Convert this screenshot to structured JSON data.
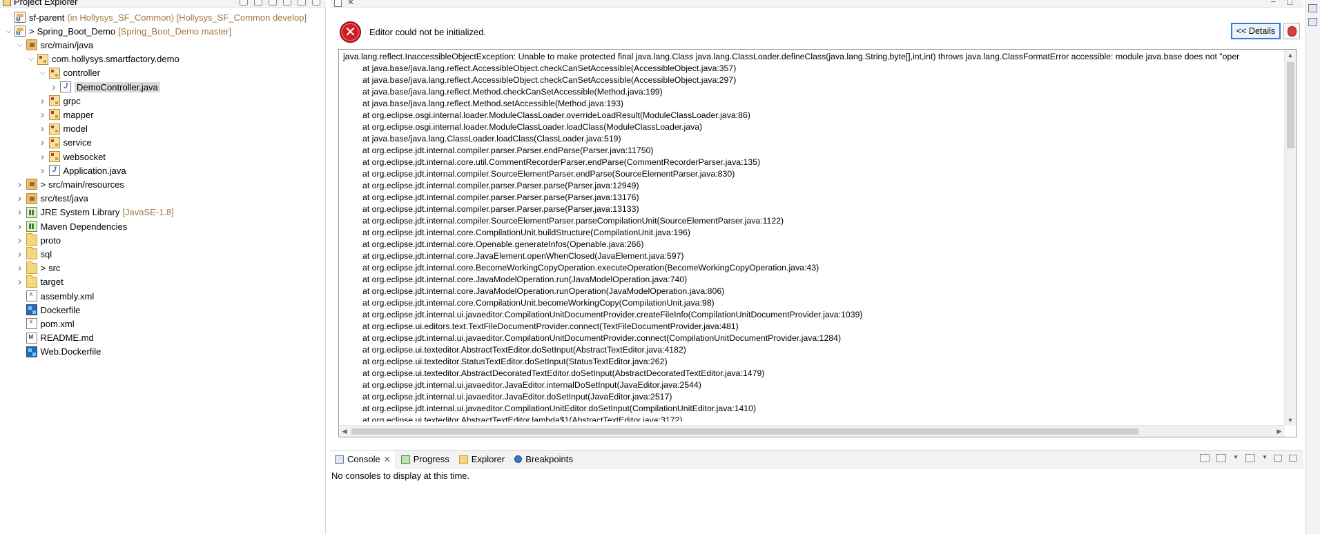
{
  "explorer": {
    "title": "Project Explorer",
    "tree": [
      {
        "id": "sf-parent",
        "depth": 0,
        "expanded": false,
        "twisty": false,
        "icon": "project-icon",
        "prefix": "",
        "label": "sf-parent",
        "decoration": "(in Hollysys_SF_Common) [Hollysys_SF_Common develop]"
      },
      {
        "id": "spring-boot-demo",
        "depth": 0,
        "expanded": true,
        "twisty": true,
        "icon": "project-icon",
        "prefix": ">",
        "label": "Spring_Boot_Demo",
        "decoration": "[Spring_Boot_Demo master]"
      },
      {
        "id": "src-main-java",
        "depth": 1,
        "expanded": true,
        "twisty": true,
        "icon": "source-folder-icon",
        "prefix": "",
        "label": "src/main/java",
        "decoration": ""
      },
      {
        "id": "pkg-demo",
        "depth": 2,
        "expanded": true,
        "twisty": true,
        "icon": "package-icon",
        "prefix": "",
        "label": "com.hollysys.smartfactory.demo",
        "decoration": ""
      },
      {
        "id": "pkg-controller",
        "depth": 3,
        "expanded": true,
        "twisty": true,
        "icon": "package-icon",
        "prefix": "",
        "label": "controller",
        "decoration": ""
      },
      {
        "id": "demo-controller",
        "depth": 4,
        "expanded": false,
        "twisty": true,
        "icon": "java-file-icon",
        "prefix": "",
        "label": "DemoController.java",
        "decoration": "",
        "selected": true
      },
      {
        "id": "pkg-grpc",
        "depth": 3,
        "expanded": false,
        "twisty": true,
        "icon": "package-icon",
        "prefix": "",
        "label": "grpc",
        "decoration": ""
      },
      {
        "id": "pkg-mapper",
        "depth": 3,
        "expanded": false,
        "twisty": true,
        "icon": "package-icon",
        "prefix": "",
        "label": "mapper",
        "decoration": ""
      },
      {
        "id": "pkg-model",
        "depth": 3,
        "expanded": false,
        "twisty": true,
        "icon": "package-icon",
        "prefix": "",
        "label": "model",
        "decoration": ""
      },
      {
        "id": "pkg-service",
        "depth": 3,
        "expanded": false,
        "twisty": true,
        "icon": "package-icon",
        "prefix": "",
        "label": "service",
        "decoration": ""
      },
      {
        "id": "pkg-websocket",
        "depth": 3,
        "expanded": false,
        "twisty": true,
        "icon": "package-icon",
        "prefix": "",
        "label": "websocket",
        "decoration": ""
      },
      {
        "id": "application",
        "depth": 3,
        "expanded": false,
        "twisty": true,
        "icon": "java-file-icon",
        "prefix": "",
        "label": "Application.java",
        "decoration": ""
      },
      {
        "id": "src-main-resources",
        "depth": 1,
        "expanded": false,
        "twisty": true,
        "icon": "source-folder-icon",
        "prefix": ">",
        "label": "src/main/resources",
        "decoration": ""
      },
      {
        "id": "src-test-java",
        "depth": 1,
        "expanded": false,
        "twisty": true,
        "icon": "source-folder-icon",
        "prefix": "",
        "label": "src/test/java",
        "decoration": ""
      },
      {
        "id": "jre",
        "depth": 1,
        "expanded": false,
        "twisty": true,
        "icon": "library-icon",
        "prefix": "",
        "label": "JRE System Library",
        "decoration": "[JavaSE-1.8]"
      },
      {
        "id": "maven-deps",
        "depth": 1,
        "expanded": false,
        "twisty": true,
        "icon": "library-icon",
        "prefix": "",
        "label": "Maven Dependencies",
        "decoration": ""
      },
      {
        "id": "proto",
        "depth": 1,
        "expanded": false,
        "twisty": true,
        "icon": "folder-icon",
        "prefix": "",
        "label": "proto",
        "decoration": ""
      },
      {
        "id": "sql",
        "depth": 1,
        "expanded": false,
        "twisty": true,
        "icon": "folder-icon",
        "prefix": "",
        "label": "sql",
        "decoration": ""
      },
      {
        "id": "src",
        "depth": 1,
        "expanded": false,
        "twisty": true,
        "icon": "folder-icon",
        "prefix": ">",
        "label": "src",
        "decoration": ""
      },
      {
        "id": "target",
        "depth": 1,
        "expanded": false,
        "twisty": true,
        "icon": "folder-icon",
        "prefix": "",
        "label": "target",
        "decoration": ""
      },
      {
        "id": "assembly",
        "depth": 1,
        "expanded": false,
        "twisty": false,
        "icon": "xml-file-icon",
        "prefix": "",
        "label": "assembly.xml",
        "decoration": ""
      },
      {
        "id": "dockerfile",
        "depth": 1,
        "expanded": false,
        "twisty": false,
        "icon": "docker-file-icon",
        "prefix": "",
        "label": "Dockerfile",
        "decoration": ""
      },
      {
        "id": "pom",
        "depth": 1,
        "expanded": false,
        "twisty": false,
        "icon": "xml-file-icon",
        "prefix": "",
        "label": "pom.xml",
        "decoration": ""
      },
      {
        "id": "readme",
        "depth": 1,
        "expanded": false,
        "twisty": false,
        "icon": "markdown-file-icon",
        "prefix": "",
        "label": "README.md",
        "decoration": ""
      },
      {
        "id": "web-dockerfile",
        "depth": 1,
        "expanded": false,
        "twisty": false,
        "icon": "docker-file-icon",
        "prefix": "",
        "label": "Web.Dockerfile",
        "decoration": ""
      }
    ]
  },
  "editor": {
    "error_message": "Editor could not be initialized.",
    "details_button": "<< Details",
    "error_icon_glyph": "✕",
    "stack_trace": [
      {
        "indent": false,
        "text": "java.lang.reflect.InaccessibleObjectException: Unable to make protected final java.lang.Class java.lang.ClassLoader.defineClass(java.lang.String,byte[],int,int) throws java.lang.ClassFormatError accessible: module java.base does not \"oper"
      },
      {
        "indent": true,
        "text": "at java.base/java.lang.reflect.AccessibleObject.checkCanSetAccessible(AccessibleObject.java:357)"
      },
      {
        "indent": true,
        "text": "at java.base/java.lang.reflect.AccessibleObject.checkCanSetAccessible(AccessibleObject.java:297)"
      },
      {
        "indent": true,
        "text": "at java.base/java.lang.reflect.Method.checkCanSetAccessible(Method.java:199)"
      },
      {
        "indent": true,
        "text": "at java.base/java.lang.reflect.Method.setAccessible(Method.java:193)"
      },
      {
        "indent": true,
        "text": "at org.eclipse.osgi.internal.loader.ModuleClassLoader.overrideLoadResult(ModuleClassLoader.java:86)"
      },
      {
        "indent": true,
        "text": "at org.eclipse.osgi.internal.loader.ModuleClassLoader.loadClass(ModuleClassLoader.java)"
      },
      {
        "indent": true,
        "text": "at java.base/java.lang.ClassLoader.loadClass(ClassLoader.java:519)"
      },
      {
        "indent": true,
        "text": "at org.eclipse.jdt.internal.compiler.parser.Parser.endParse(Parser.java:11750)"
      },
      {
        "indent": true,
        "text": "at org.eclipse.jdt.internal.core.util.CommentRecorderParser.endParse(CommentRecorderParser.java:135)"
      },
      {
        "indent": true,
        "text": "at org.eclipse.jdt.internal.compiler.SourceElementParser.endParse(SourceElementParser.java:830)"
      },
      {
        "indent": true,
        "text": "at org.eclipse.jdt.internal.compiler.parser.Parser.parse(Parser.java:12949)"
      },
      {
        "indent": true,
        "text": "at org.eclipse.jdt.internal.compiler.parser.Parser.parse(Parser.java:13176)"
      },
      {
        "indent": true,
        "text": "at org.eclipse.jdt.internal.compiler.parser.Parser.parse(Parser.java:13133)"
      },
      {
        "indent": true,
        "text": "at org.eclipse.jdt.internal.compiler.SourceElementParser.parseCompilationUnit(SourceElementParser.java:1122)"
      },
      {
        "indent": true,
        "text": "at org.eclipse.jdt.internal.core.CompilationUnit.buildStructure(CompilationUnit.java:196)"
      },
      {
        "indent": true,
        "text": "at org.eclipse.jdt.internal.core.Openable.generateInfos(Openable.java:266)"
      },
      {
        "indent": true,
        "text": "at org.eclipse.jdt.internal.core.JavaElement.openWhenClosed(JavaElement.java:597)"
      },
      {
        "indent": true,
        "text": "at org.eclipse.jdt.internal.core.BecomeWorkingCopyOperation.executeOperation(BecomeWorkingCopyOperation.java:43)"
      },
      {
        "indent": true,
        "text": "at org.eclipse.jdt.internal.core.JavaModelOperation.run(JavaModelOperation.java:740)"
      },
      {
        "indent": true,
        "text": "at org.eclipse.jdt.internal.core.JavaModelOperation.runOperation(JavaModelOperation.java:806)"
      },
      {
        "indent": true,
        "text": "at org.eclipse.jdt.internal.core.CompilationUnit.becomeWorkingCopy(CompilationUnit.java:98)"
      },
      {
        "indent": true,
        "text": "at org.eclipse.jdt.internal.ui.javaeditor.CompilationUnitDocumentProvider.createFileInfo(CompilationUnitDocumentProvider.java:1039)"
      },
      {
        "indent": true,
        "text": "at org.eclipse.ui.editors.text.TextFileDocumentProvider.connect(TextFileDocumentProvider.java:481)"
      },
      {
        "indent": true,
        "text": "at org.eclipse.jdt.internal.ui.javaeditor.CompilationUnitDocumentProvider.connect(CompilationUnitDocumentProvider.java:1284)"
      },
      {
        "indent": true,
        "text": "at org.eclipse.ui.texteditor.AbstractTextEditor.doSetInput(AbstractTextEditor.java:4182)"
      },
      {
        "indent": true,
        "text": "at org.eclipse.ui.texteditor.StatusTextEditor.doSetInput(StatusTextEditor.java:262)"
      },
      {
        "indent": true,
        "text": "at org.eclipse.ui.texteditor.AbstractDecoratedTextEditor.doSetInput(AbstractDecoratedTextEditor.java:1479)"
      },
      {
        "indent": true,
        "text": "at org.eclipse.jdt.internal.ui.javaeditor.JavaEditor.internalDoSetInput(JavaEditor.java:2544)"
      },
      {
        "indent": true,
        "text": "at org.eclipse.jdt.internal.ui.javaeditor.JavaEditor.doSetInput(JavaEditor.java:2517)"
      },
      {
        "indent": true,
        "text": "at org.eclipse.jdt.internal.ui.javaeditor.CompilationUnitEditor.doSetInput(CompilationUnitEditor.java:1410)"
      },
      {
        "indent": true,
        "text": "at org.eclipse.ui.texteditor.AbstractTextEditor.lambda$1(AbstractTextEditor.java:3172)"
      }
    ]
  },
  "console": {
    "tabs": [
      {
        "label": "Console",
        "icon": "console-icon",
        "active": true,
        "closable": true
      },
      {
        "label": "Progress",
        "icon": "progress-icon",
        "active": false,
        "closable": false
      },
      {
        "label": "Explorer",
        "icon": "explorer-icon",
        "active": false,
        "closable": false
      },
      {
        "label": "Breakpoints",
        "icon": "breakpoints-icon",
        "active": false,
        "closable": false
      }
    ],
    "message": "No consoles to display at this time."
  },
  "colors": {
    "error_red": "#cc1f24",
    "decoration_brown": "#a3753f",
    "selection_gray": "#dadada",
    "details_border_blue": "#2e7dd1"
  }
}
